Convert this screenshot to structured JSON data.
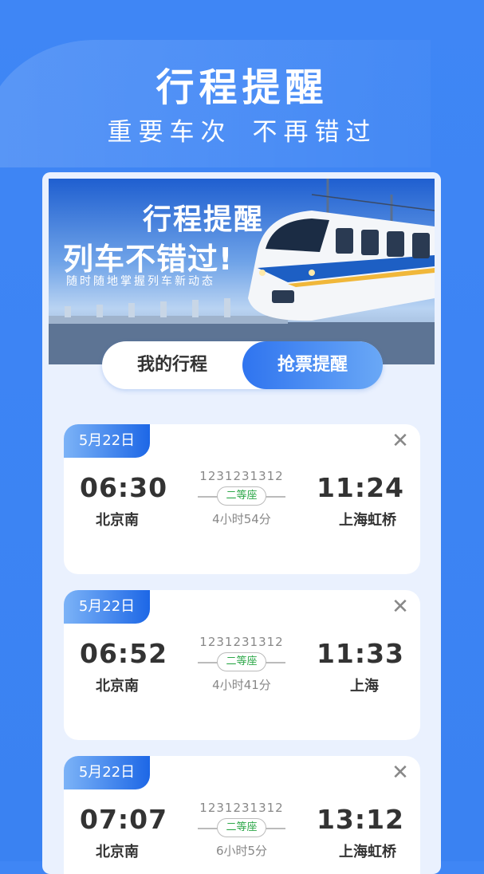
{
  "header": {
    "title": "行程提醒",
    "subtitle_a": "重要车次",
    "subtitle_b": "不再错过"
  },
  "banner": {
    "line1": "行程提醒",
    "line2": "列车不错过!",
    "line3": "随时随地掌握列车新动态"
  },
  "tabs": [
    {
      "label": "我的行程",
      "active": false
    },
    {
      "label": "抢票提醒",
      "active": true
    }
  ],
  "trips": [
    {
      "date": "5月22日",
      "dep_time": "06:30",
      "dep_station": "北京南",
      "train_no": "1231231312",
      "seat": "二等座",
      "duration": "4小时54分",
      "arr_time": "11:24",
      "arr_station": "上海虹桥"
    },
    {
      "date": "5月22日",
      "dep_time": "06:52",
      "dep_station": "北京南",
      "train_no": "1231231312",
      "seat": "二等座",
      "duration": "4小时41分",
      "arr_time": "11:33",
      "arr_station": "上海"
    },
    {
      "date": "5月22日",
      "dep_time": "07:07",
      "dep_station": "北京南",
      "train_no": "1231231312",
      "seat": "二等座",
      "duration": "6小时5分",
      "arr_time": "13:12",
      "arr_station": "上海虹桥"
    }
  ],
  "icons": {
    "close": "close-icon"
  },
  "colors": {
    "primary": "#3a82f2",
    "seat_green": "#2ea84a",
    "tag_start": "#7cb3f7",
    "tag_end": "#1d67e6"
  }
}
